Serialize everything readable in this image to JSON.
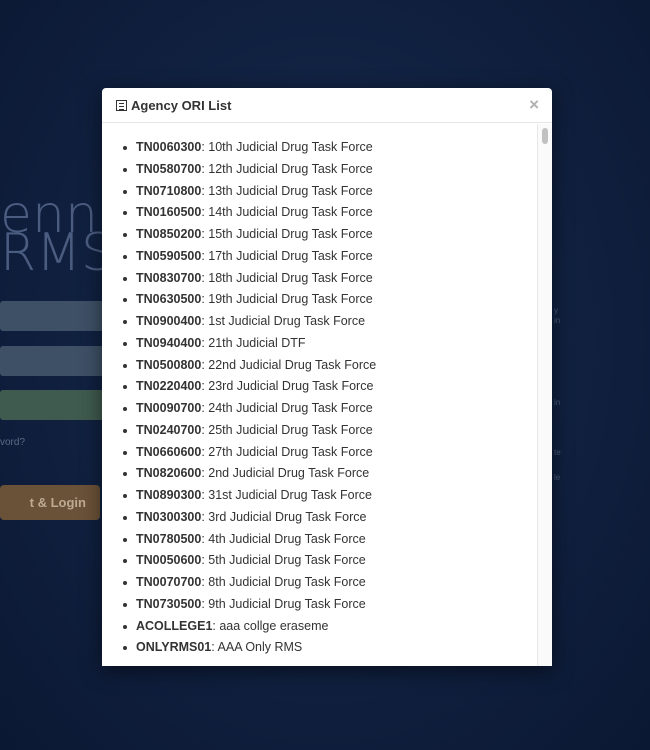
{
  "background": {
    "title_line1": "ennes",
    "title_line2": "RMS",
    "forgot_text": "vord?",
    "login_button": "t & Login",
    "right_fragments": [
      "y",
      "in",
      "in",
      "te",
      "le"
    ]
  },
  "modal": {
    "title": "Agency ORI List",
    "close_label": "×",
    "items": [
      {
        "code": "TN0060300",
        "name": ": 10th Judicial Drug Task Force"
      },
      {
        "code": "TN0580700",
        "name": ": 12th Judicial Drug Task Force"
      },
      {
        "code": "TN0710800",
        "name": ": 13th Judicial Drug Task Force"
      },
      {
        "code": "TN0160500",
        "name": ": 14th Judicial Drug Task Force"
      },
      {
        "code": "TN0850200",
        "name": ": 15th Judicial Drug Task Force"
      },
      {
        "code": "TN0590500",
        "name": ": 17th Judicial Drug Task Force"
      },
      {
        "code": "TN0830700",
        "name": ": 18th Judicial Drug Task Force"
      },
      {
        "code": "TN0630500",
        "name": ": 19th Judicial Drug Task Force"
      },
      {
        "code": "TN0900400",
        "name": ": 1st Judicial Drug Task Force"
      },
      {
        "code": "TN0940400",
        "name": ": 21th Judicial DTF"
      },
      {
        "code": "TN0500800",
        "name": ": 22nd Judicial Drug Task Force"
      },
      {
        "code": "TN0220400",
        "name": ": 23rd Judicial Drug Task Force"
      },
      {
        "code": "TN0090700",
        "name": ": 24th Judicial Drug Task Force"
      },
      {
        "code": "TN0240700",
        "name": ": 25th Judicial Drug Task Force"
      },
      {
        "code": "TN0660600",
        "name": ": 27th Judicial Drug Task Force"
      },
      {
        "code": "TN0820600",
        "name": ": 2nd Judicial Drug Task Force"
      },
      {
        "code": "TN0890300",
        "name": ": 31st Judicial Drug Task Force"
      },
      {
        "code": "TN0300300",
        "name": ": 3rd Judicial Drug Task Force"
      },
      {
        "code": "TN0780500",
        "name": ": 4th Judicial Drug Task Force"
      },
      {
        "code": "TN0050600",
        "name": ": 5th Judicial Drug Task Force"
      },
      {
        "code": "TN0070700",
        "name": ": 8th Judicial Drug Task Force"
      },
      {
        "code": "TN0730500",
        "name": ": 9th Judicial Drug Task Force"
      },
      {
        "code": "ACOLLEGE1",
        "name": ": aaa collge eraseme"
      },
      {
        "code": "ONLYRMS01",
        "name": ": AAA Only RMS"
      }
    ]
  }
}
